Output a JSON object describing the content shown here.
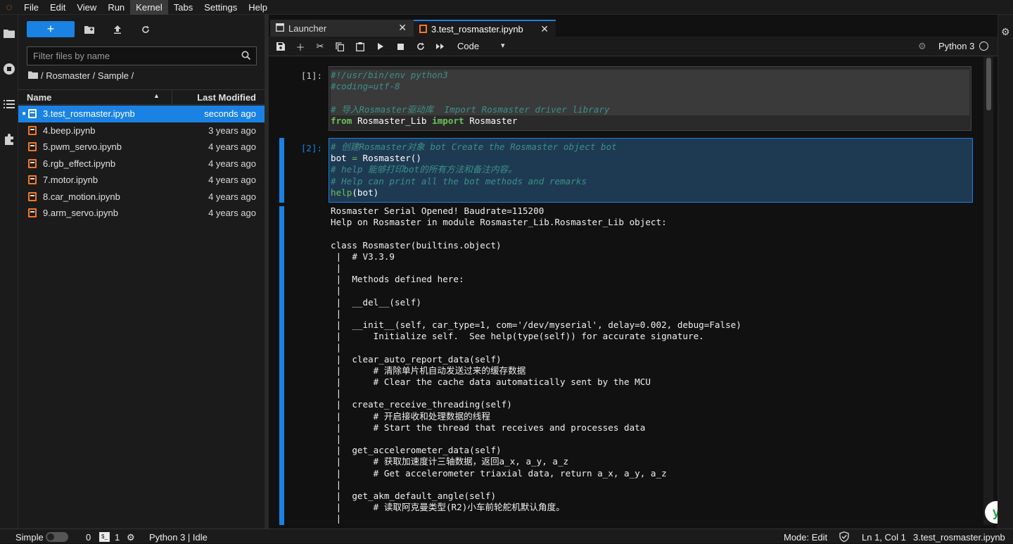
{
  "menubar": {
    "items": [
      "File",
      "Edit",
      "View",
      "Run",
      "Kernel",
      "Tabs",
      "Settings",
      "Help"
    ],
    "active": "Kernel"
  },
  "filebrowser": {
    "new_label": "+",
    "filter_placeholder": "Filter files by name",
    "breadcrumb": "/ Rosmaster / Sample /",
    "col_name": "Name",
    "col_modified": "Last Modified",
    "files": [
      {
        "name": "3.test_rosmaster.ipynb",
        "modified": "seconds ago",
        "selected": true,
        "running": true
      },
      {
        "name": "4.beep.ipynb",
        "modified": "3 years ago"
      },
      {
        "name": "5.pwm_servo.ipynb",
        "modified": "4 years ago"
      },
      {
        "name": "6.rgb_effect.ipynb",
        "modified": "4 years ago"
      },
      {
        "name": "7.motor.ipynb",
        "modified": "4 years ago"
      },
      {
        "name": "8.car_motion.ipynb",
        "modified": "4 years ago"
      },
      {
        "name": "9.arm_servo.ipynb",
        "modified": "4 years ago"
      }
    ]
  },
  "tabs": {
    "launcher": "Launcher",
    "notebook": "3.test_rosmaster.ipynb"
  },
  "nbtoolbar": {
    "cell_type": "Code",
    "kernel": "Python 3"
  },
  "cells": {
    "c1_prompt": "[1]:",
    "c2_prompt": "[2]:"
  },
  "output_text": "Rosmaster Serial Opened! Baudrate=115200\nHelp on Rosmaster in module Rosmaster_Lib.Rosmaster_Lib object:\n\nclass Rosmaster(builtins.object)\n |  # V3.3.9\n |  \n |  Methods defined here:\n |  \n |  __del__(self)\n |  \n |  __init__(self, car_type=1, com='/dev/myserial', delay=0.002, debug=False)\n |      Initialize self.  See help(type(self)) for accurate signature.\n |  \n |  clear_auto_report_data(self)\n |      # 清除单片机自动发送过来的缓存数据\n |      # Clear the cache data automatically sent by the MCU\n |  \n |  create_receive_threading(self)\n |      # 开启接收和处理数据的线程\n |      # Start the thread that receives and processes data\n |  \n |  get_accelerometer_data(self)\n |      # 获取加速度计三轴数据，返回a_x, a_y, a_z\n |      # Get accelerometer triaxial data, return a_x, a_y, a_z\n |  \n |  get_akm_default_angle(self)\n |      # 读取阿克曼类型(R2)小车前轮舵机默认角度。\n |  ",
  "statusbar": {
    "mode_label": "Simple",
    "terminals": "0",
    "kernels": "1",
    "kernel_status": "Python 3 | Idle",
    "edit_mode": "Mode: Edit",
    "cursor": "Ln 1, Col 1",
    "filename": "3.test_rosmaster.ipynb"
  },
  "colors": {
    "accent": "#1a82e2",
    "notebook_icon": "#f37726",
    "comment": "#3d8f87",
    "keyword": "#6fc05a"
  },
  "icons": [
    "jupyter-logo-icon",
    "folder-icon",
    "running-icon",
    "toc-icon",
    "extension-icon",
    "new-folder-icon",
    "upload-icon",
    "refresh-icon",
    "search-icon",
    "save-icon",
    "add-icon",
    "cut-icon",
    "copy-icon",
    "paste-icon",
    "run-icon",
    "stop-icon",
    "restart-icon",
    "fast-forward-icon",
    "gear-icon"
  ]
}
